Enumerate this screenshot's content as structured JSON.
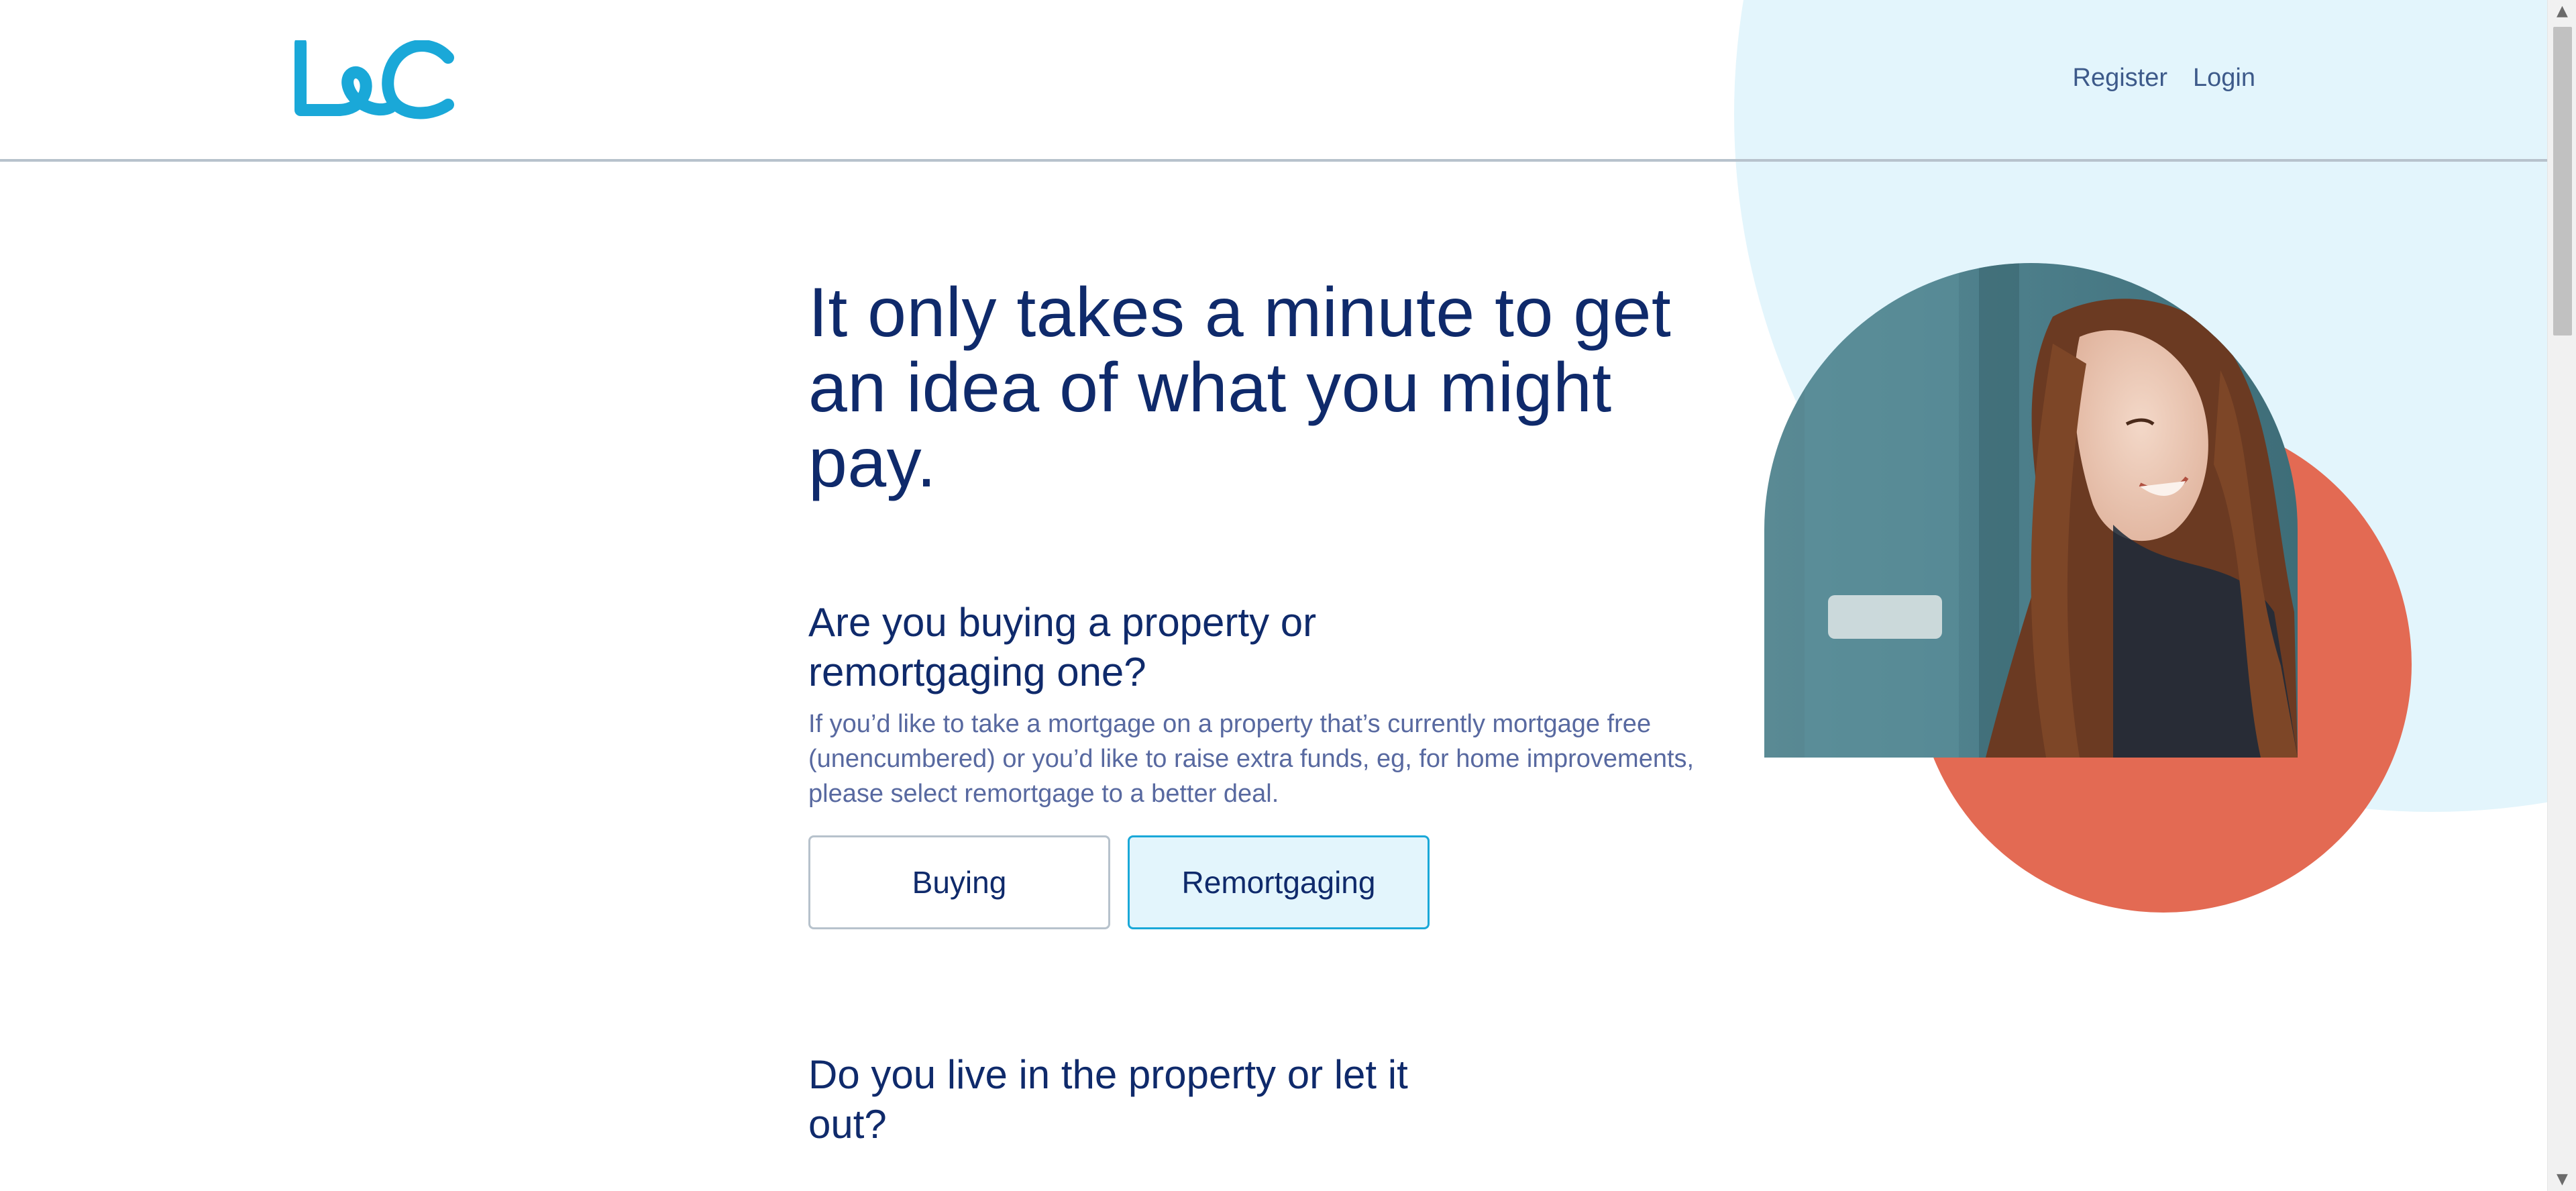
{
  "header": {
    "logo_alt": "L&C",
    "nav": {
      "register": "Register",
      "login": "Login"
    }
  },
  "hero": {
    "title": "It only takes a minute to get an idea of what you might pay."
  },
  "question_property_type": {
    "title": "Are you buying a property or remortgaging one?",
    "help": "If you’d like to take a mortgage on a property that’s currently mortgage free (unencumbered) or you’d like to raise extra funds, eg, for home improvements, please select remortgage to a better deal.",
    "options": [
      "Buying",
      "Remortgaging"
    ],
    "selected": "Remortgaging"
  },
  "question_occupancy": {
    "title": "Do you live in the property or let it out?"
  },
  "scrollbar": {
    "up_icon": "▲",
    "down_icon": "▼"
  },
  "colors": {
    "brand_blue": "#1aa8d8",
    "navy": "#0f2a6b",
    "light_blue_bg": "#e3f5fc",
    "accent_orange": "#e36a53"
  }
}
